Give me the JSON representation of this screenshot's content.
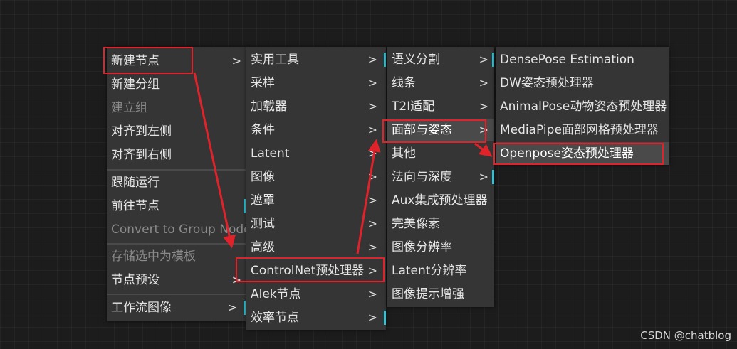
{
  "menu1": {
    "items": [
      {
        "label": "新建节点",
        "sub": true,
        "mark": false,
        "disabled": false
      },
      {
        "label": "新建分组",
        "sub": false,
        "mark": false,
        "disabled": false
      },
      {
        "label": "建立组",
        "sub": false,
        "mark": false,
        "disabled": true
      },
      {
        "label": "对齐到左侧",
        "sub": false,
        "mark": false,
        "disabled": false
      },
      {
        "label": "对齐到右侧",
        "sub": false,
        "mark": false,
        "disabled": false
      },
      {
        "label": "跟随运行",
        "sub": false,
        "mark": false,
        "disabled": false
      },
      {
        "label": "前往节点",
        "sub": false,
        "mark": true,
        "disabled": false
      },
      {
        "label": "Convert to Group Node",
        "sub": false,
        "mark": false,
        "disabled": true
      },
      {
        "label": "存储选中为模板",
        "sub": false,
        "mark": false,
        "disabled": true
      },
      {
        "label": "节点预设",
        "sub": true,
        "mark": false,
        "disabled": false
      },
      {
        "label": "工作流图像",
        "sub": true,
        "mark": true,
        "disabled": false
      }
    ]
  },
  "menu2": {
    "items": [
      {
        "label": "实用工具",
        "sub": true,
        "mark": true
      },
      {
        "label": "采样",
        "sub": true,
        "mark": false
      },
      {
        "label": "加载器",
        "sub": true,
        "mark": false
      },
      {
        "label": "条件",
        "sub": true,
        "mark": false
      },
      {
        "label": "Latent",
        "sub": true,
        "mark": false
      },
      {
        "label": "图像",
        "sub": true,
        "mark": false
      },
      {
        "label": "遮罩",
        "sub": true,
        "mark": false
      },
      {
        "label": "测试",
        "sub": true,
        "mark": false
      },
      {
        "label": "高级",
        "sub": true,
        "mark": false
      },
      {
        "label": "ControlNet预处理器",
        "sub": true,
        "mark": false
      },
      {
        "label": "Alek节点",
        "sub": true,
        "mark": false
      },
      {
        "label": "效率节点",
        "sub": true,
        "mark": true
      }
    ]
  },
  "menu3": {
    "items": [
      {
        "label": "语义分割",
        "sub": true,
        "mark": true
      },
      {
        "label": "线条",
        "sub": true,
        "mark": false
      },
      {
        "label": "T2I适配",
        "sub": true,
        "mark": false
      },
      {
        "label": "面部与姿态",
        "sub": true,
        "mark": false
      },
      {
        "label": "其他",
        "sub": false,
        "mark": false
      },
      {
        "label": "法向与深度",
        "sub": true,
        "mark": true
      },
      {
        "label": "Aux集成预处理器",
        "sub": false,
        "mark": false
      },
      {
        "label": "完美像素",
        "sub": false,
        "mark": false
      },
      {
        "label": "图像分辨率",
        "sub": false,
        "mark": false
      },
      {
        "label": "Latent分辨率",
        "sub": false,
        "mark": false
      },
      {
        "label": "图像提示增强",
        "sub": false,
        "mark": false
      }
    ]
  },
  "menu4": {
    "items": [
      {
        "label": "DensePose Estimation",
        "sub": false,
        "mark": false
      },
      {
        "label": "DW姿态预处理器",
        "sub": false,
        "mark": false
      },
      {
        "label": "AnimalPose动物姿态预处理器",
        "sub": false,
        "mark": false
      },
      {
        "label": "MediaPipe面部网格预处理器",
        "sub": false,
        "mark": false
      },
      {
        "label": "Openpose姿态预处理器",
        "sub": false,
        "mark": false
      }
    ]
  },
  "chevron_glyph": ">",
  "watermark": "CSDN @chatblog",
  "colors": {
    "accent": "#2ec3d6",
    "annotation": "#e0232a",
    "menu_bg": "#353535",
    "canvas_bg": "#1c1c1c"
  }
}
